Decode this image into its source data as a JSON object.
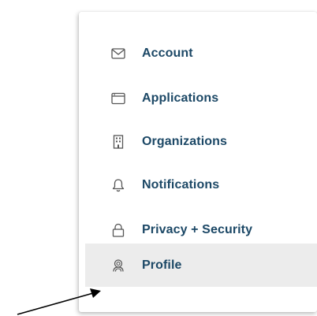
{
  "menu": {
    "items": [
      {
        "label": "Account",
        "icon": "envelope-icon"
      },
      {
        "label": "Applications",
        "icon": "window-icon"
      },
      {
        "label": "Organizations",
        "icon": "building-icon"
      },
      {
        "label": "Notifications",
        "icon": "bell-icon"
      },
      {
        "label": "Privacy + Security",
        "icon": "lock-icon"
      },
      {
        "label": "Profile",
        "icon": "profile-icon",
        "active": true
      }
    ]
  },
  "colors": {
    "label": "#1c4866",
    "icon": "#555555",
    "active_background": "#ececec",
    "arrow": "#000000"
  }
}
